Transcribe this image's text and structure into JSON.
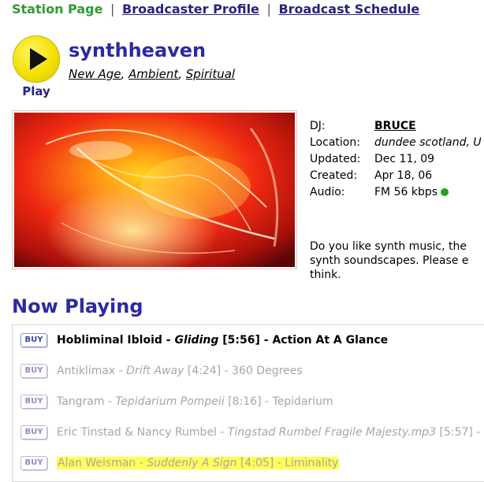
{
  "nav": {
    "station_page": "Station Page",
    "sep1": "|",
    "broadcaster_profile": "Broadcaster Profile",
    "sep2": "|",
    "broadcast_schedule": "Broadcast Schedule"
  },
  "player": {
    "play_label": "Play"
  },
  "station": {
    "name": "synthheaven",
    "genres": [
      "New Age",
      "Ambient",
      "Spiritual"
    ],
    "genre_sep": ", "
  },
  "info": {
    "dj_label": "DJ:",
    "dj_value": "BRUCE",
    "location_label": "Location:",
    "location_value": "dundee scotland, U",
    "updated_label": "Updated:",
    "updated_value": "Dec 11, 09",
    "created_label": "Created:",
    "created_value": "Apr 18, 06",
    "audio_label": "Audio:",
    "audio_value": "FM 56 kbps",
    "audio_status_color": "#1ea51e"
  },
  "description": {
    "line1": "Do you like synth music, the",
    "line2": "synth soundscapes. Please e",
    "line3": "think."
  },
  "now_playing": {
    "heading": "Now Playing",
    "buy_label": "BUY",
    "tracks": [
      {
        "artist": "Hobliminal Ibloid",
        "dash1": " - ",
        "title": "Gliding",
        "duration": " [5:56]",
        "dash2": " - ",
        "album": "Action At A Glance"
      },
      {
        "artist": "Antiklimax",
        "dash1": " - ",
        "title": "Drift Away",
        "duration": " [4:24]",
        "dash2": " - ",
        "album": "360 Degrees"
      },
      {
        "artist": "Tangram",
        "dash1": " - ",
        "title": "Tepidarium Pompeii",
        "duration": " [8:16]",
        "dash2": " - ",
        "album": "Tepidarium"
      },
      {
        "artist": "Eric Tinstad & Nancy Rumbel",
        "dash1": " - ",
        "title": "Tingstad Rumbel Fragile Majesty.mp3",
        "duration": " [5:57]",
        "dash2": " -",
        "album": ""
      },
      {
        "artist": "Alan Weisman",
        "dash1": " - ",
        "title": "Suddenly A Sign",
        "duration": " [4:05]",
        "dash2": " - ",
        "album": "Liminality"
      }
    ]
  },
  "colors": {
    "title_blue": "#2c2a9e",
    "nav_active_green": "#2f9a2f",
    "play_yellow": "#f3e100",
    "highlight_yellow": "#ffff55"
  },
  "icons": {
    "play": "play-triangle-icon",
    "status": "green-dot-icon"
  }
}
